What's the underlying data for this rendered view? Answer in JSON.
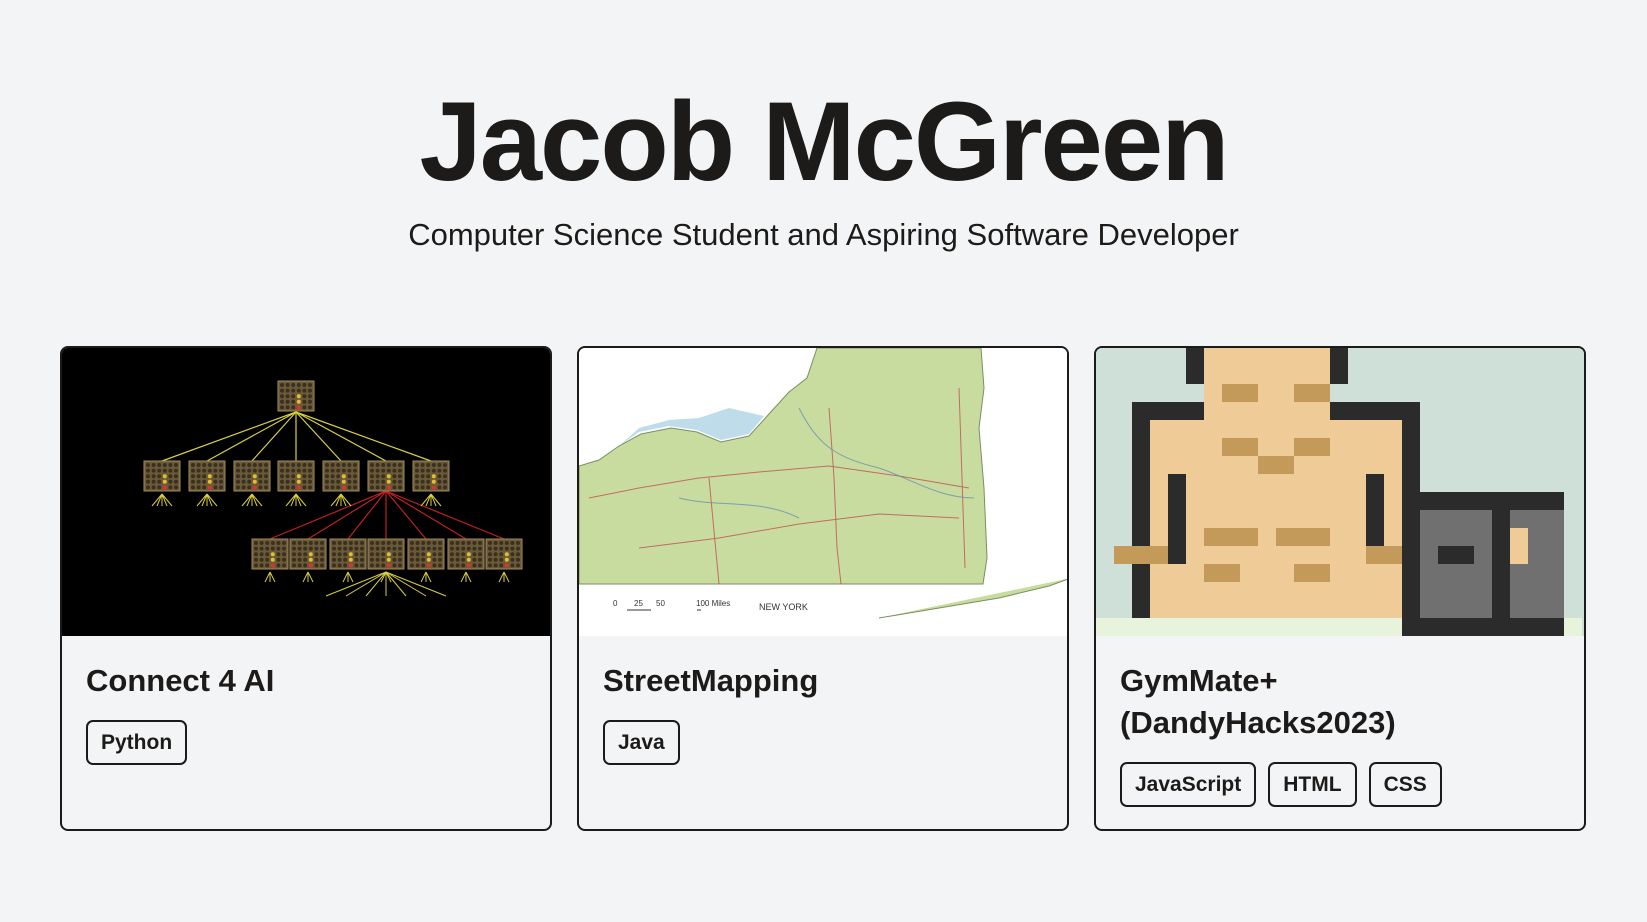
{
  "header": {
    "name": "Jacob McGreen",
    "tagline": "Computer Science Student and Aspiring Software Developer"
  },
  "projects": [
    {
      "title": "Connect 4 AI",
      "image": "minimax-game-tree-diagram",
      "tags": [
        "Python"
      ]
    },
    {
      "title": "StreetMapping",
      "image": "new-york-state-road-map",
      "map_labels": {
        "scale": [
          "0",
          "25",
          "50",
          "100 Miles"
        ],
        "region": "NEW YORK"
      },
      "tags": [
        "Java"
      ]
    },
    {
      "title": "GymMate+ (DandyHacks2023)",
      "image": "pixel-art-muscle-man-with-dumbbell",
      "tags": [
        "JavaScript",
        "HTML",
        "CSS"
      ]
    }
  ],
  "colors": {
    "background": "#f3f4f6",
    "text": "#1c1b19",
    "border": "#1c1b19"
  }
}
